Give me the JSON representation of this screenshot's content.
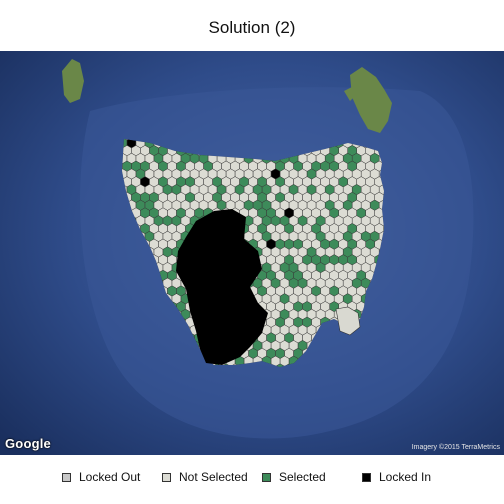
{
  "title": "Solution (2)",
  "map": {
    "attribution_logo": "Google",
    "imagery_credit": "Imagery ©2015 TerraMetrics",
    "hex_grid": {
      "cell_categories": [
        "Locked Out",
        "Not Selected",
        "Selected",
        "Locked In"
      ]
    }
  },
  "legend": {
    "items": [
      {
        "label": "Locked Out",
        "color": "#c8c8c8"
      },
      {
        "label": "Not Selected",
        "color": "#dcdcd4"
      },
      {
        "label": "Selected",
        "color": "#3d8b5a"
      },
      {
        "label": "Locked In",
        "color": "#000000"
      }
    ]
  },
  "colors": {
    "ocean_deep": "#1b3366",
    "ocean_shelf": "#3f5e9c",
    "land": "#6e8a4a"
  }
}
